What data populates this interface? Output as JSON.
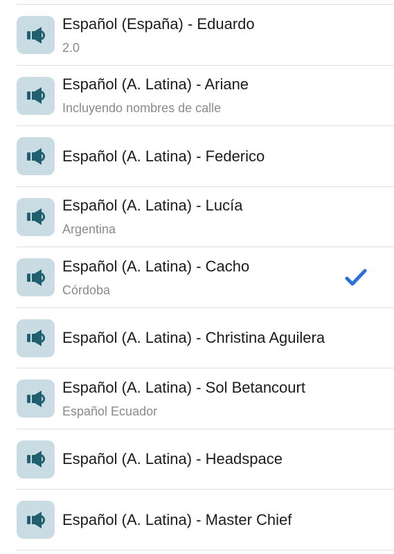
{
  "colors": {
    "icon_tile_bg": "#c9dbe3",
    "icon_fg": "#1f5f6e",
    "checkmark": "#2a6fdb",
    "separator": "#dedede"
  },
  "icon": "speaker-icon",
  "voices": [
    {
      "title": "Español (España) - Eduardo",
      "subtitle": "2.0",
      "selected": false
    },
    {
      "title": "Español (A. Latina) - Ariane",
      "subtitle": "Incluyendo nombres de calle",
      "selected": false
    },
    {
      "title": "Español (A. Latina) - Federico",
      "subtitle": "",
      "selected": false
    },
    {
      "title": "Español (A. Latina) - Lucía",
      "subtitle": "Argentina",
      "selected": false
    },
    {
      "title": "Español (A. Latina) - Cacho",
      "subtitle": "Córdoba",
      "selected": true
    },
    {
      "title": "Español (A. Latina) - Christina Aguilera",
      "subtitle": "",
      "selected": false
    },
    {
      "title": "Español (A. Latina) - Sol Betancourt",
      "subtitle": "Español Ecuador",
      "selected": false
    },
    {
      "title": "Español (A. Latina) - Headspace",
      "subtitle": "",
      "selected": false
    },
    {
      "title": "Español (A. Latina) - Master Chief",
      "subtitle": "",
      "selected": false
    }
  ]
}
